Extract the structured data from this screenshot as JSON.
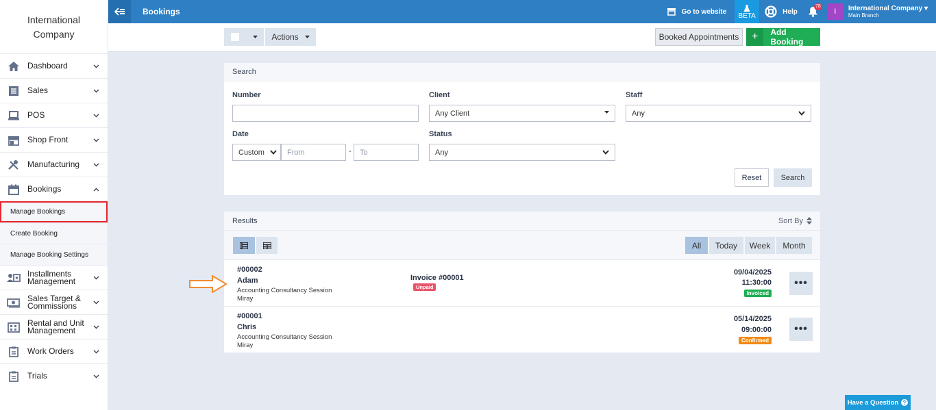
{
  "app": {
    "company_line1": "International",
    "company_line2": "Company"
  },
  "sidebar": {
    "items": [
      {
        "label": "Dashboard"
      },
      {
        "label": "Sales"
      },
      {
        "label": "POS"
      },
      {
        "label": "Shop Front"
      },
      {
        "label": "Manufacturing"
      },
      {
        "label": "Bookings"
      }
    ],
    "sub_items": [
      {
        "label": "Manage Bookings"
      },
      {
        "label": "Create Booking"
      },
      {
        "label": "Manage Booking Settings"
      }
    ],
    "items2": [
      {
        "label": "Installments Management",
        "l1": "Installments",
        "l2": "Management"
      },
      {
        "label": "Sales Target & Commissions",
        "l1": "Sales Target &",
        "l2": "Commissions"
      },
      {
        "label": "Rental and Unit Management",
        "l1": "Rental and Unit",
        "l2": "Management"
      },
      {
        "label": "Work Orders"
      },
      {
        "label": "Trials"
      }
    ]
  },
  "topbar": {
    "title": "Bookings",
    "go_to_website": "Go to website",
    "beta": "BETA",
    "help": "Help",
    "notif_count": "78",
    "avatar_letter": "I",
    "company_name": "International Company",
    "branch": "Main Branch"
  },
  "toolbar": {
    "actions_label": "Actions",
    "booked_appointments_label": "Booked Appointments",
    "add_booking_label": "Add Booking"
  },
  "search": {
    "title": "Search",
    "number_label": "Number",
    "client_label": "Client",
    "client_value": "Any Client",
    "staff_label": "Staff",
    "staff_value": "Any",
    "date_label": "Date",
    "date_mode": "Custom",
    "from_placeholder": "From",
    "dash": "-",
    "to_placeholder": "To",
    "status_label": "Status",
    "status_value": "Any",
    "reset_label": "Reset",
    "search_label": "Search"
  },
  "results": {
    "title": "Results",
    "sort_by": "Sort By",
    "tabs": [
      "All",
      "Today",
      "Week",
      "Month"
    ],
    "rows": [
      {
        "number": "#00002",
        "client": "Adam",
        "service": "Accounting Consultancy Session",
        "staff": "Miray",
        "invoice": "Invoice #00001",
        "invoice_status": "Unpaid",
        "date": "09/04/2025",
        "time": "11:30:00",
        "status": "Invoiced"
      },
      {
        "number": "#00001",
        "client": "Chris",
        "service": "Accounting Consultancy Session",
        "staff": "Miray",
        "date": "05/14/2025",
        "time": "09:00:00",
        "status": "Confirmed"
      }
    ]
  },
  "help_button": {
    "label": "Have a Question"
  },
  "colors": {
    "topbar": "#2e7fc4",
    "add_booking": "#1fad55",
    "unpaid": "#e8546b",
    "invoiced": "#1fad55",
    "confirmed": "#f28a12",
    "highlight_border": "#e3262d",
    "arrow": "#f08a30"
  }
}
